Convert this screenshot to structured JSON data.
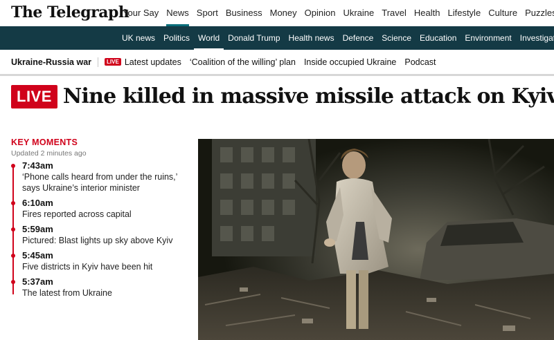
{
  "header": {
    "logo": "The Telegraph",
    "nav": [
      "Your Say",
      "News",
      "Sport",
      "Business",
      "Money",
      "Opinion",
      "Ukraine",
      "Travel",
      "Health",
      "Lifestyle",
      "Culture",
      "Puzzles"
    ],
    "active_nav": "News"
  },
  "subnav": {
    "items": [
      "UK news",
      "Politics",
      "World",
      "Donald Trump",
      "Health news",
      "Defence",
      "Science",
      "Education",
      "Environment",
      "Investigations"
    ],
    "active": "World"
  },
  "storybar": {
    "title": "Ukraine-Russia war",
    "live_label": "LIVE",
    "links": [
      "Latest updates",
      "‘Coalition of the willing’ plan",
      "Inside occupied Ukraine",
      "Podcast"
    ]
  },
  "article": {
    "live_badge": "LIVE",
    "headline": "Nine killed in massive missile attack on Kyiv"
  },
  "key_moments": {
    "title": "KEY MOMENTS",
    "updated": "Updated 2 minutes ago",
    "entries": [
      {
        "time": "7:43am",
        "text": "‘Phone calls heard from under the ruins,’ says Ukraine’s interior minister"
      },
      {
        "time": "6:10am",
        "text": "Fires reported across capital"
      },
      {
        "time": "5:59am",
        "text": "Pictured: Blast lights up sky above Kyiv"
      },
      {
        "time": "5:45am",
        "text": "Five districts in Kyiv have been hit"
      },
      {
        "time": "5:37am",
        "text": "The latest from Ukraine"
      }
    ]
  },
  "colors": {
    "brand_red": "#d0021b",
    "subnav_bg": "#143a45",
    "active_underline": "#0a6e7a"
  }
}
